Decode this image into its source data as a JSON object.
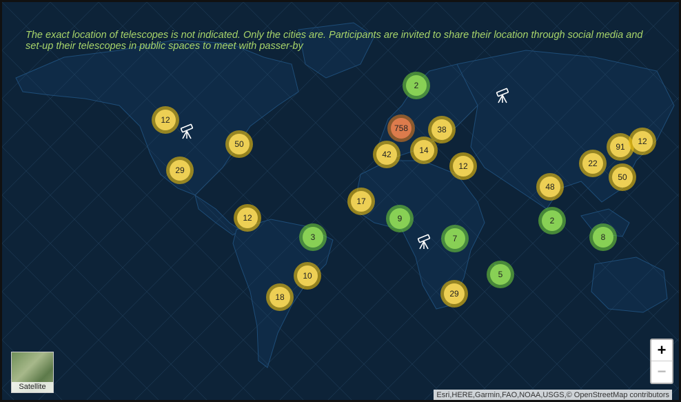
{
  "notice": "The exact location of telescopes is not indicated. Only the cities are. Participants are invited to share their location through social media and set-up their telescopes in public spaces to meet with passer-by",
  "clusters": [
    {
      "count": "2",
      "color": "g"
    },
    {
      "count": "12",
      "color": "y"
    },
    {
      "count": "50",
      "color": "y"
    },
    {
      "count": "29",
      "color": "y"
    },
    {
      "count": "758",
      "color": "o"
    },
    {
      "count": "38",
      "color": "y"
    },
    {
      "count": "42",
      "color": "y"
    },
    {
      "count": "14",
      "color": "y"
    },
    {
      "count": "12",
      "color": "y"
    },
    {
      "count": "22",
      "color": "y"
    },
    {
      "count": "91",
      "color": "y"
    },
    {
      "count": "12",
      "color": "y"
    },
    {
      "count": "50",
      "color": "y"
    },
    {
      "count": "48",
      "color": "y"
    },
    {
      "count": "17",
      "color": "y"
    },
    {
      "count": "9",
      "color": "g"
    },
    {
      "count": "12",
      "color": "y"
    },
    {
      "count": "3",
      "color": "g"
    },
    {
      "count": "2",
      "color": "g"
    },
    {
      "count": "8",
      "color": "g"
    },
    {
      "count": "7",
      "color": "g"
    },
    {
      "count": "10",
      "color": "y"
    },
    {
      "count": "5",
      "color": "g"
    },
    {
      "count": "18",
      "color": "y"
    },
    {
      "count": "29",
      "color": "y"
    }
  ],
  "markers": [
    "telescope-icon",
    "telescope-icon",
    "telescope-icon"
  ],
  "controls": {
    "zoom_in": "+",
    "zoom_out": "−",
    "basemap_toggle": "Satellite"
  },
  "attribution": "Esri,HERE,Garmin,FAO,NOAA,USGS,© OpenStreetMap contributors"
}
